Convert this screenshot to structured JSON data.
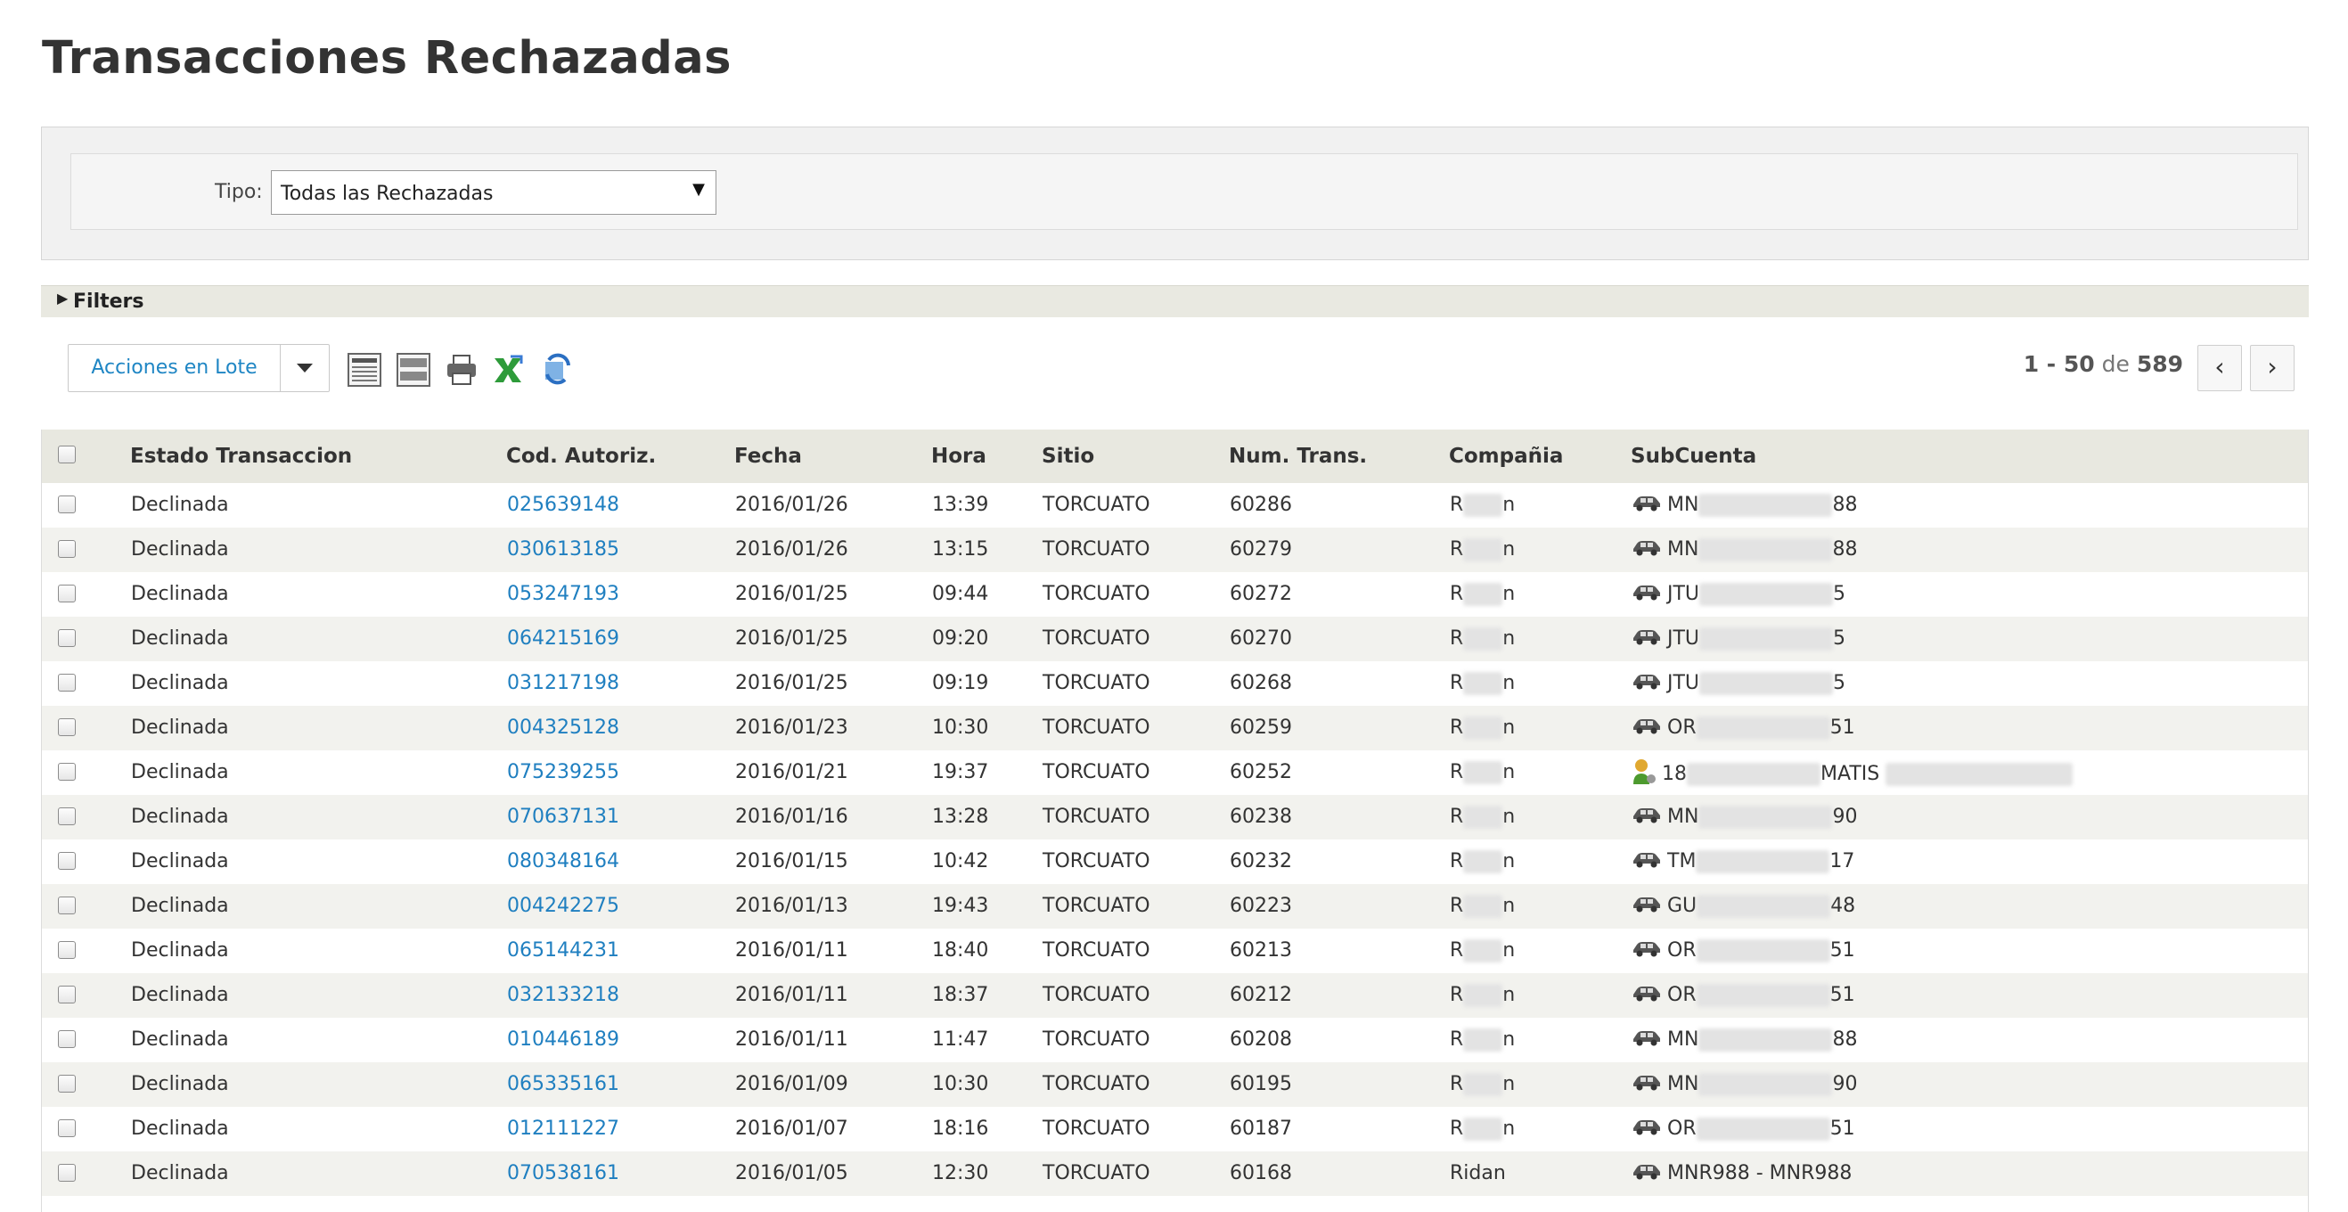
{
  "page": {
    "title": "Transacciones Rechazadas"
  },
  "filter": {
    "tipo_label": "Tipo:",
    "tipo_value": "Todas las Rechazadas"
  },
  "filters_bar": {
    "label": "Filters"
  },
  "toolbar": {
    "batch_label": "Acciones en Lote",
    "icons": [
      "grid-expanded-icon",
      "grid-compact-icon",
      "print-icon",
      "excel-export-icon",
      "refresh-icon"
    ]
  },
  "pager": {
    "range": "1 - 50",
    "of_word": "de",
    "total": "589"
  },
  "table": {
    "columns": [
      "Estado Transaccion",
      "Cod. Autoriz.",
      "Fecha",
      "Hora",
      "Sitio",
      "Num. Trans.",
      "Compañia",
      "SubCuenta"
    ],
    "rows": [
      {
        "estado": "Declinada",
        "cod": "025639148",
        "fecha": "2016/01/26",
        "hora": "13:39",
        "sitio": "TORCUATO",
        "num": "60286",
        "comp_a": "R",
        "comp_b": "n",
        "sub_icon": "car-icon",
        "sub_a": "MN",
        "sub_b": "88"
      },
      {
        "estado": "Declinada",
        "cod": "030613185",
        "fecha": "2016/01/26",
        "hora": "13:15",
        "sitio": "TORCUATO",
        "num": "60279",
        "comp_a": "R",
        "comp_b": "n",
        "sub_icon": "car-icon",
        "sub_a": "MN",
        "sub_b": "88"
      },
      {
        "estado": "Declinada",
        "cod": "053247193",
        "fecha": "2016/01/25",
        "hora": "09:44",
        "sitio": "TORCUATO",
        "num": "60272",
        "comp_a": "R",
        "comp_b": "n",
        "sub_icon": "car-icon",
        "sub_a": "JTU",
        "sub_b": "5"
      },
      {
        "estado": "Declinada",
        "cod": "064215169",
        "fecha": "2016/01/25",
        "hora": "09:20",
        "sitio": "TORCUATO",
        "num": "60270",
        "comp_a": "R",
        "comp_b": "n",
        "sub_icon": "car-icon",
        "sub_a": "JTU",
        "sub_b": "5"
      },
      {
        "estado": "Declinada",
        "cod": "031217198",
        "fecha": "2016/01/25",
        "hora": "09:19",
        "sitio": "TORCUATO",
        "num": "60268",
        "comp_a": "R",
        "comp_b": "n",
        "sub_icon": "car-icon",
        "sub_a": "JTU",
        "sub_b": "5"
      },
      {
        "estado": "Declinada",
        "cod": "004325128",
        "fecha": "2016/01/23",
        "hora": "10:30",
        "sitio": "TORCUATO",
        "num": "60259",
        "comp_a": "R",
        "comp_b": "n",
        "sub_icon": "car-icon",
        "sub_a": "OR",
        "sub_b": "51"
      },
      {
        "estado": "Declinada",
        "cod": "075239255",
        "fecha": "2016/01/21",
        "hora": "19:37",
        "sitio": "TORCUATO",
        "num": "60252",
        "comp_a": "R",
        "comp_b": "n",
        "sub_icon": "person-icon",
        "sub_a": "18",
        "sub_b": "MATIS"
      },
      {
        "estado": "Declinada",
        "cod": "070637131",
        "fecha": "2016/01/16",
        "hora": "13:28",
        "sitio": "TORCUATO",
        "num": "60238",
        "comp_a": "R",
        "comp_b": "n",
        "sub_icon": "car-icon",
        "sub_a": "MN",
        "sub_b": "90"
      },
      {
        "estado": "Declinada",
        "cod": "080348164",
        "fecha": "2016/01/15",
        "hora": "10:42",
        "sitio": "TORCUATO",
        "num": "60232",
        "comp_a": "R",
        "comp_b": "n",
        "sub_icon": "car-icon",
        "sub_a": "TM",
        "sub_b": "17"
      },
      {
        "estado": "Declinada",
        "cod": "004242275",
        "fecha": "2016/01/13",
        "hora": "19:43",
        "sitio": "TORCUATO",
        "num": "60223",
        "comp_a": "R",
        "comp_b": "n",
        "sub_icon": "car-icon",
        "sub_a": "GU",
        "sub_b": "48"
      },
      {
        "estado": "Declinada",
        "cod": "065144231",
        "fecha": "2016/01/11",
        "hora": "18:40",
        "sitio": "TORCUATO",
        "num": "60213",
        "comp_a": "R",
        "comp_b": "n",
        "sub_icon": "car-icon",
        "sub_a": "OR",
        "sub_b": "51"
      },
      {
        "estado": "Declinada",
        "cod": "032133218",
        "fecha": "2016/01/11",
        "hora": "18:37",
        "sitio": "TORCUATO",
        "num": "60212",
        "comp_a": "R",
        "comp_b": "n",
        "sub_icon": "car-icon",
        "sub_a": "OR",
        "sub_b": "51"
      },
      {
        "estado": "Declinada",
        "cod": "010446189",
        "fecha": "2016/01/11",
        "hora": "11:47",
        "sitio": "TORCUATO",
        "num": "60208",
        "comp_a": "R",
        "comp_b": "n",
        "sub_icon": "car-icon",
        "sub_a": "MN",
        "sub_b": "88"
      },
      {
        "estado": "Declinada",
        "cod": "065335161",
        "fecha": "2016/01/09",
        "hora": "10:30",
        "sitio": "TORCUATO",
        "num": "60195",
        "comp_a": "R",
        "comp_b": "n",
        "sub_icon": "car-icon",
        "sub_a": "MN",
        "sub_b": "90"
      },
      {
        "estado": "Declinada",
        "cod": "012111227",
        "fecha": "2016/01/07",
        "hora": "18:16",
        "sitio": "TORCUATO",
        "num": "60187",
        "comp_a": "R",
        "comp_b": "n",
        "sub_icon": "car-icon",
        "sub_a": "OR",
        "sub_b": "51"
      },
      {
        "estado": "Declinada",
        "cod": "070538161",
        "fecha": "2016/01/05",
        "hora": "12:30",
        "sitio": "TORCUATO",
        "num": "60168",
        "comp_a": "Ridan",
        "comp_b": "",
        "sub_icon": "car-icon",
        "sub_a": "MNR988 - MNR988",
        "sub_b": ""
      }
    ]
  }
}
